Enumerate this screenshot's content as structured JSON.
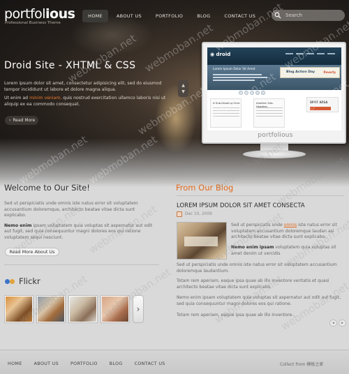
{
  "logo": {
    "name_light": "portfol",
    "name_bold": "ious",
    "tagline": "Professional Business Theme"
  },
  "nav": [
    "HOME",
    "ABOUT US",
    "PORTFOLIO",
    "BLOG",
    "CONTACT US"
  ],
  "search": {
    "placeholder": "Search",
    "icon": "magnifier-icon"
  },
  "hero": {
    "title": "Droid Site - XHTML & CSS",
    "p1": "Lorem ipsum dolor sit amet, consectetur adipisicing elit, sed do eiusmod tempor incididunt ut labore et dolore magna aliqua.",
    "p2_a": "Ut enim ad ",
    "p2_highlight": "minim veniam,",
    "p2_b": " quis nostrud exercitation ullamco laboris nisi ut aliquip ex ea commodo consequat.",
    "read_more": "Read More",
    "slider_prev": "▲",
    "slider_next": "▼"
  },
  "monitor": {
    "brand": "portfolious",
    "screen": {
      "logo": "◉ droid",
      "banner_title": "Lorem Ipsum Dolor Sit Amet",
      "promo_title": "Blog Action Day",
      "promo_badge": "Poverty",
      "box1_title": "A Sub-Heading Here",
      "box2_title": "Another Sub-Heading",
      "spot_title": "SPOT AREA"
    }
  },
  "welcome": {
    "title": "Welcome to Our Site!",
    "p1": "Sed ut perspiciatis unde omnis iste natus error sit voluptatem accusantium doloremque, architecto beatae vitae dicta sunt explicabo.",
    "p2_bold": "Nemo enim",
    "p2": " ipsam voluptatem quia voluptas sit aspernatur aut odit aut fugit, sed quia consequuntur magni dolores eos qui ratione voluptatem sequi nesciunt.",
    "button": "Read More About Us"
  },
  "flickr": {
    "title": "Flickr",
    "dot_colors": [
      "#3d73c8",
      "#e0a33a"
    ],
    "next": "›"
  },
  "blog": {
    "heading": "From Our Blog",
    "post_title": "LOREM IPSUM DOLOR SIT AMET CONSECTA",
    "date": "Dec 10, 2009",
    "p1_a": "Sed ut perspiciatis unde ",
    "p1_highlight": "omnis",
    "p1_b": " iste natus error sit voluptatem accusantium doloremque laudan asi architecto beatae vitae dicta sunt explicabo.",
    "p2_bold": "Nemo enim ipsam",
    "p2": " voluptatem quia voluptas sit amet denim ut vercidis",
    "p3": "Sed ut perspiciatis unde omnis iste natus error sit voluptatem accusantium doloremque laudantium.",
    "p4": "Totam rem aperiam, eaque ipsa quae ab illo inventore veritatis et quasi architecto beatae vitae dicta sunt explicabo.",
    "p5": "Nemo enim ipsam voluptatem quia voluptas sit aspernatur aut odit aut fugit, sed quia consequuntur magni dolores eos qui ratione.",
    "p6": "Totam rem aperiam, eaque ipsa quae ab illo inventore.",
    "prev": "◂",
    "next": "▸"
  },
  "footer": {
    "nav": [
      "HOME",
      "ABOUT US",
      "PORTFOLIO",
      "BLOG",
      "CONTACT US"
    ],
    "copyright": "Collect from 模板之家"
  },
  "watermark": "webmoban.net"
}
